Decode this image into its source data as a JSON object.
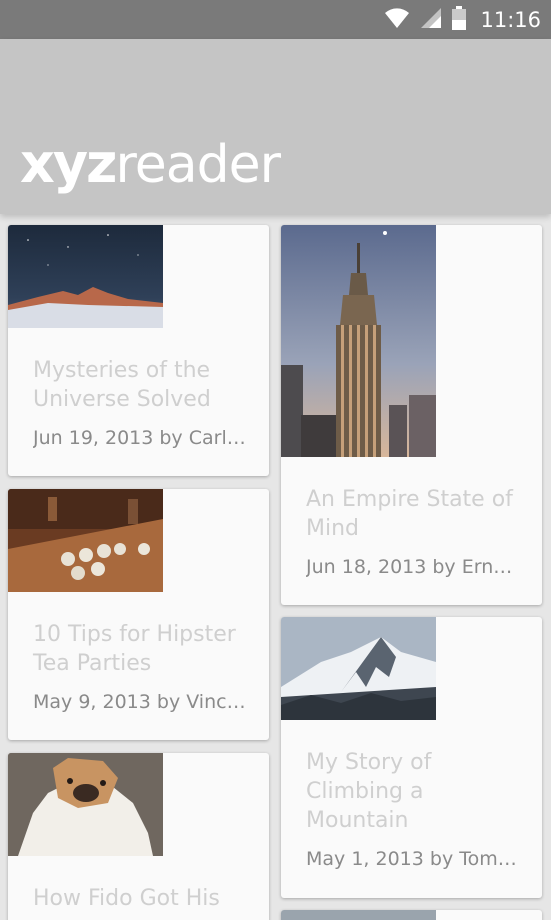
{
  "status_bar": {
    "time": "11:16",
    "icons": [
      "wifi-icon",
      "signal-icon",
      "battery-icon"
    ]
  },
  "app_bar": {
    "logo_bold": "xyz",
    "logo_light": "reader",
    "background": "#c5c5c5"
  },
  "articles": [
    {
      "title": "Mysteries of the Universe Solved",
      "subtitle": "Jun 19, 2013 by Carl…",
      "thumb": "milky-way-mountain"
    },
    {
      "title": "10 Tips for Hipster Tea Parties",
      "subtitle": "May 9, 2013 by Vinc…",
      "thumb": "tea-cups-table"
    },
    {
      "title": "How Fido Got His",
      "subtitle": "",
      "thumb": "bulldog"
    },
    {
      "title": "An Empire State of Mind",
      "subtitle": "Jun 18, 2013 by Ern…",
      "thumb": "empire-state-building"
    },
    {
      "title": "My Story of Climbing a Mountain",
      "subtitle": "May 1, 2013 by Tom…",
      "thumb": "snowy-mountain"
    }
  ]
}
